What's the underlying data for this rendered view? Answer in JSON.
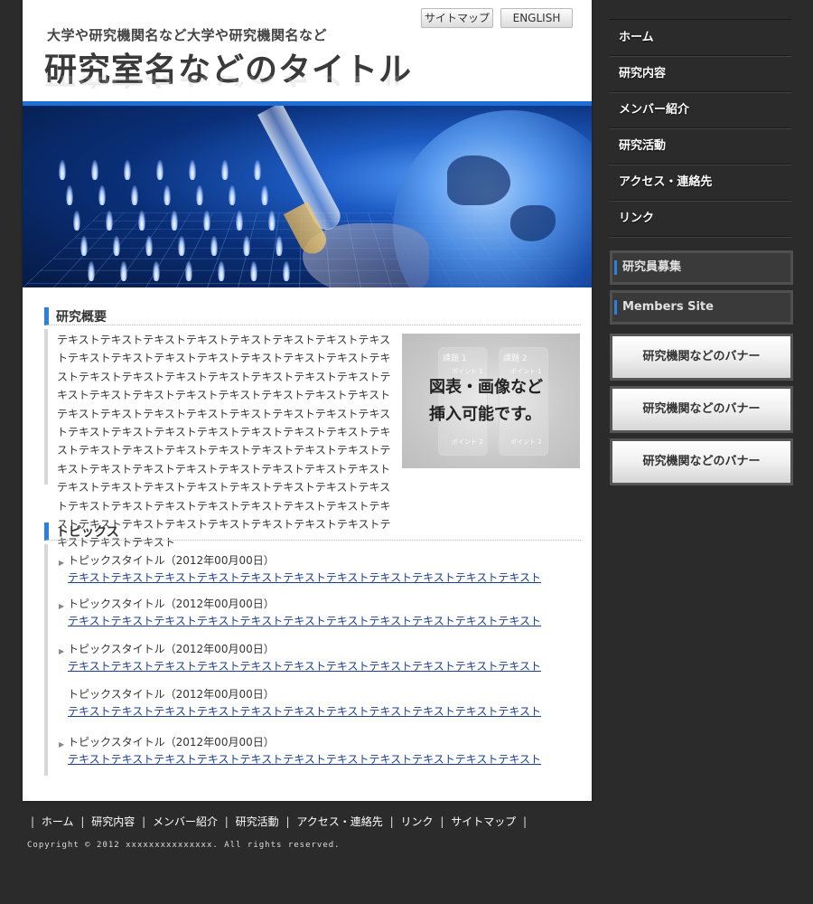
{
  "header": {
    "sitemap_label": "サイトマップ",
    "english_label": "ENGLISH",
    "subtitle": "大学や研究機関名など大学や研究機関名など",
    "title": "研究室名などのタイトル"
  },
  "overview": {
    "heading": "研究概要",
    "text": "テキストテキストテキストテキストテキストテキストテキストテキストテキストテキストテキストテキストテキストテキストテキストテキストテキストテキストテキストテキストテキストテキストテキストテキストテキストテキストテキストテキストテキストテキストテキストテキストテキストテキストテキストテキストテキストテキストテキストテキストテキストテキストテキストテキストテキストテキストテキストテキストテキストテキストテキストテキストテキストテキストテキストテキストテキストテキストテキストテキストテキストテキストテキストテキストテキストテキストテキストテキストテキストテキストテキストテキストテキストテキストテキストテキストテキストテキストテキストテキストテキストテキストテキストテキストテキストテキストテキストテキスト",
    "figure": {
      "line1": "図表・画像など",
      "line2": "挿入可能です。",
      "box1_title": "課題 1",
      "box2_title": "課題 2",
      "box1_point1": "ポイント 1",
      "box2_point1": "ポイント 1",
      "box1_point2": "ポイント 2",
      "box2_point2": "ポイント 2"
    }
  },
  "topics": {
    "heading": "トピックス",
    "items": [
      {
        "title": "トピックスタイトル（2012年00月00日）",
        "link": "テキストテキストテキストテキストテキストテキストテキストテキストテキストテキストテキスト"
      },
      {
        "title": "トピックスタイトル（2012年00月00日）",
        "link": "テキストテキストテキストテキストテキストテキストテキストテキストテキストテキストテキスト"
      },
      {
        "title": "トピックスタイトル（2012年00月00日）",
        "link": "テキストテキストテキストテキストテキストテキストテキストテキストテキストテキストテキスト"
      },
      {
        "title": "トピックスタイトル（2012年00月00日）",
        "link": "テキストテキストテキストテキストテキストテキストテキストテキストテキストテキストテキスト"
      },
      {
        "title": "トピックスタイトル（2012年00月00日）",
        "link": "テキストテキストテキストテキストテキストテキストテキストテキストテキストテキストテキスト"
      }
    ]
  },
  "nav": {
    "items": [
      "ホーム",
      "研究内容",
      "メンバー紹介",
      "研究活動",
      "アクセス・連絡先",
      "リンク"
    ]
  },
  "side": {
    "recruit_label": "研究員募集",
    "members_label": "Members Site",
    "banners": [
      "研究機関などのバナー",
      "研究機関などのバナー",
      "研究機関などのバナー"
    ]
  },
  "footer": {
    "links": [
      "ホーム",
      "研究内容",
      "メンバー紹介",
      "研究活動",
      "アクセス・連絡先",
      "リンク",
      "サイトマップ"
    ],
    "copyright": "Copyright © 2012 xxxxxxxxxxxxxxx. All rights reserved."
  },
  "colors": {
    "accent": "#2b7fe0",
    "background": "#2b2b2b",
    "link": "#1a3f8c"
  }
}
